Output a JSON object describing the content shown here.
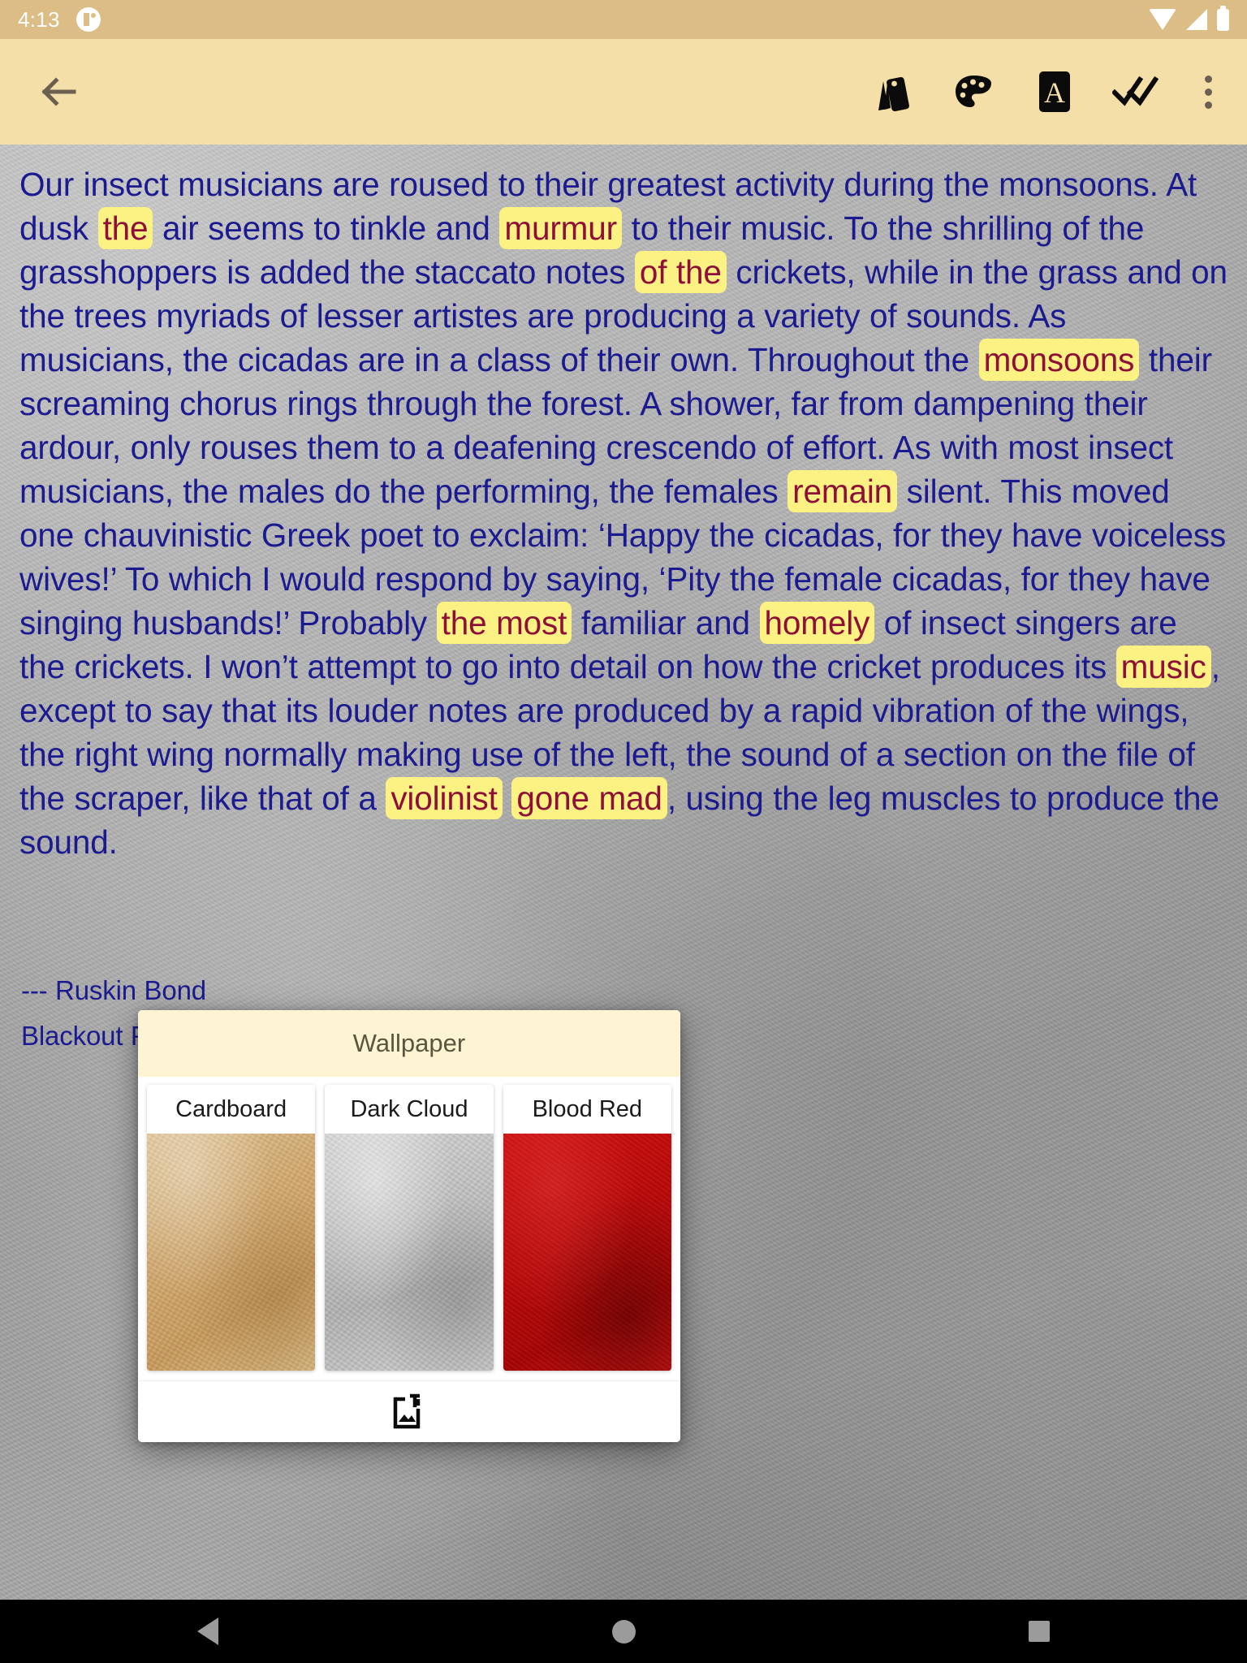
{
  "status_bar": {
    "time": "4:13",
    "icons": [
      "notification-badge-icon",
      "wifi-icon",
      "cellular-signal-icon",
      "battery-icon"
    ]
  },
  "toolbar": {
    "back_label": "back-arrow",
    "actions": [
      {
        "name": "wallpaper-icon",
        "label": "Wallpaper"
      },
      {
        "name": "palette-icon",
        "label": "Colors"
      },
      {
        "name": "font-icon",
        "label": "Font"
      },
      {
        "name": "double-check-icon",
        "label": "Done"
      },
      {
        "name": "overflow-menu-icon",
        "label": "More options"
      }
    ]
  },
  "article": {
    "paragraph_html": "Our insect musicians are roused to their greatest activity during the monsoons. At dusk <span class=\"hl\">the</span> air seems to tinkle and <span class=\"hl\">murmur</span> to their music. To the shrilling of the grasshoppers is added the staccato notes <span class=\"hl\">of the</span> crickets, while in the grass and on the trees myriads of lesser artistes are producing a variety of sounds. As musicians, the cicadas are in a class of their own. Throughout the <span class=\"hl\">monsoons</span> their screaming chorus rings through the forest. A shower, far from dampening their ardour, only rouses them to a deafening crescendo of effort. As with most insect musicians, the males do the performing, the females <span class=\"hl\">remain</span> silent. This moved one chauvinistic Greek poet to exclaim: ‘Happy the cicadas, for they have voiceless wives!’ To which I would respond by saying, ‘Pity the female cicadas, for they have singing husbands!’ Probably <span class=\"hl\">the most</span> familiar and <span class=\"hl\">homely</span> of insect singers are the crickets. I won’t attempt to go into detail on how the cricket produces its <span class=\"hl\">music</span>, except to say that its louder notes are produced by a rapid vibration of the wings, the right wing normally making use of the left, the sound of a section on the file of the scraper, like that of a <span class=\"hl\">violinist</span> <span class=\"hl\">gone mad</span>, using the leg muscles to produce the sound.",
    "attribution_line_1": "--- Ruskin Bond",
    "attribution_line_2": "Blackout Poem",
    "text_color": "#1b1b8f",
    "highlight_bg": "#fbf283",
    "highlight_color": "#8e1038"
  },
  "dialog": {
    "title": "Wallpaper",
    "options": [
      {
        "label": "Cardboard",
        "swatch": "cardboard",
        "color": "#d0a768"
      },
      {
        "label": "Dark Cloud",
        "swatch": "dark-cloud",
        "color": "#bdbdbd"
      },
      {
        "label": "Blood Red",
        "swatch": "blood-red",
        "color": "#bf0c0c"
      }
    ],
    "footer_action": "add-image-icon",
    "header_bg": "#fdf4d3"
  },
  "nav_bar": {
    "buttons": [
      "back",
      "home",
      "recents"
    ]
  },
  "theme": {
    "status_bar_bg": "#dcbd86",
    "toolbar_bg": "#f5dfa8",
    "page_bg": "#9e9e9e",
    "nav_bg": "#000000"
  }
}
